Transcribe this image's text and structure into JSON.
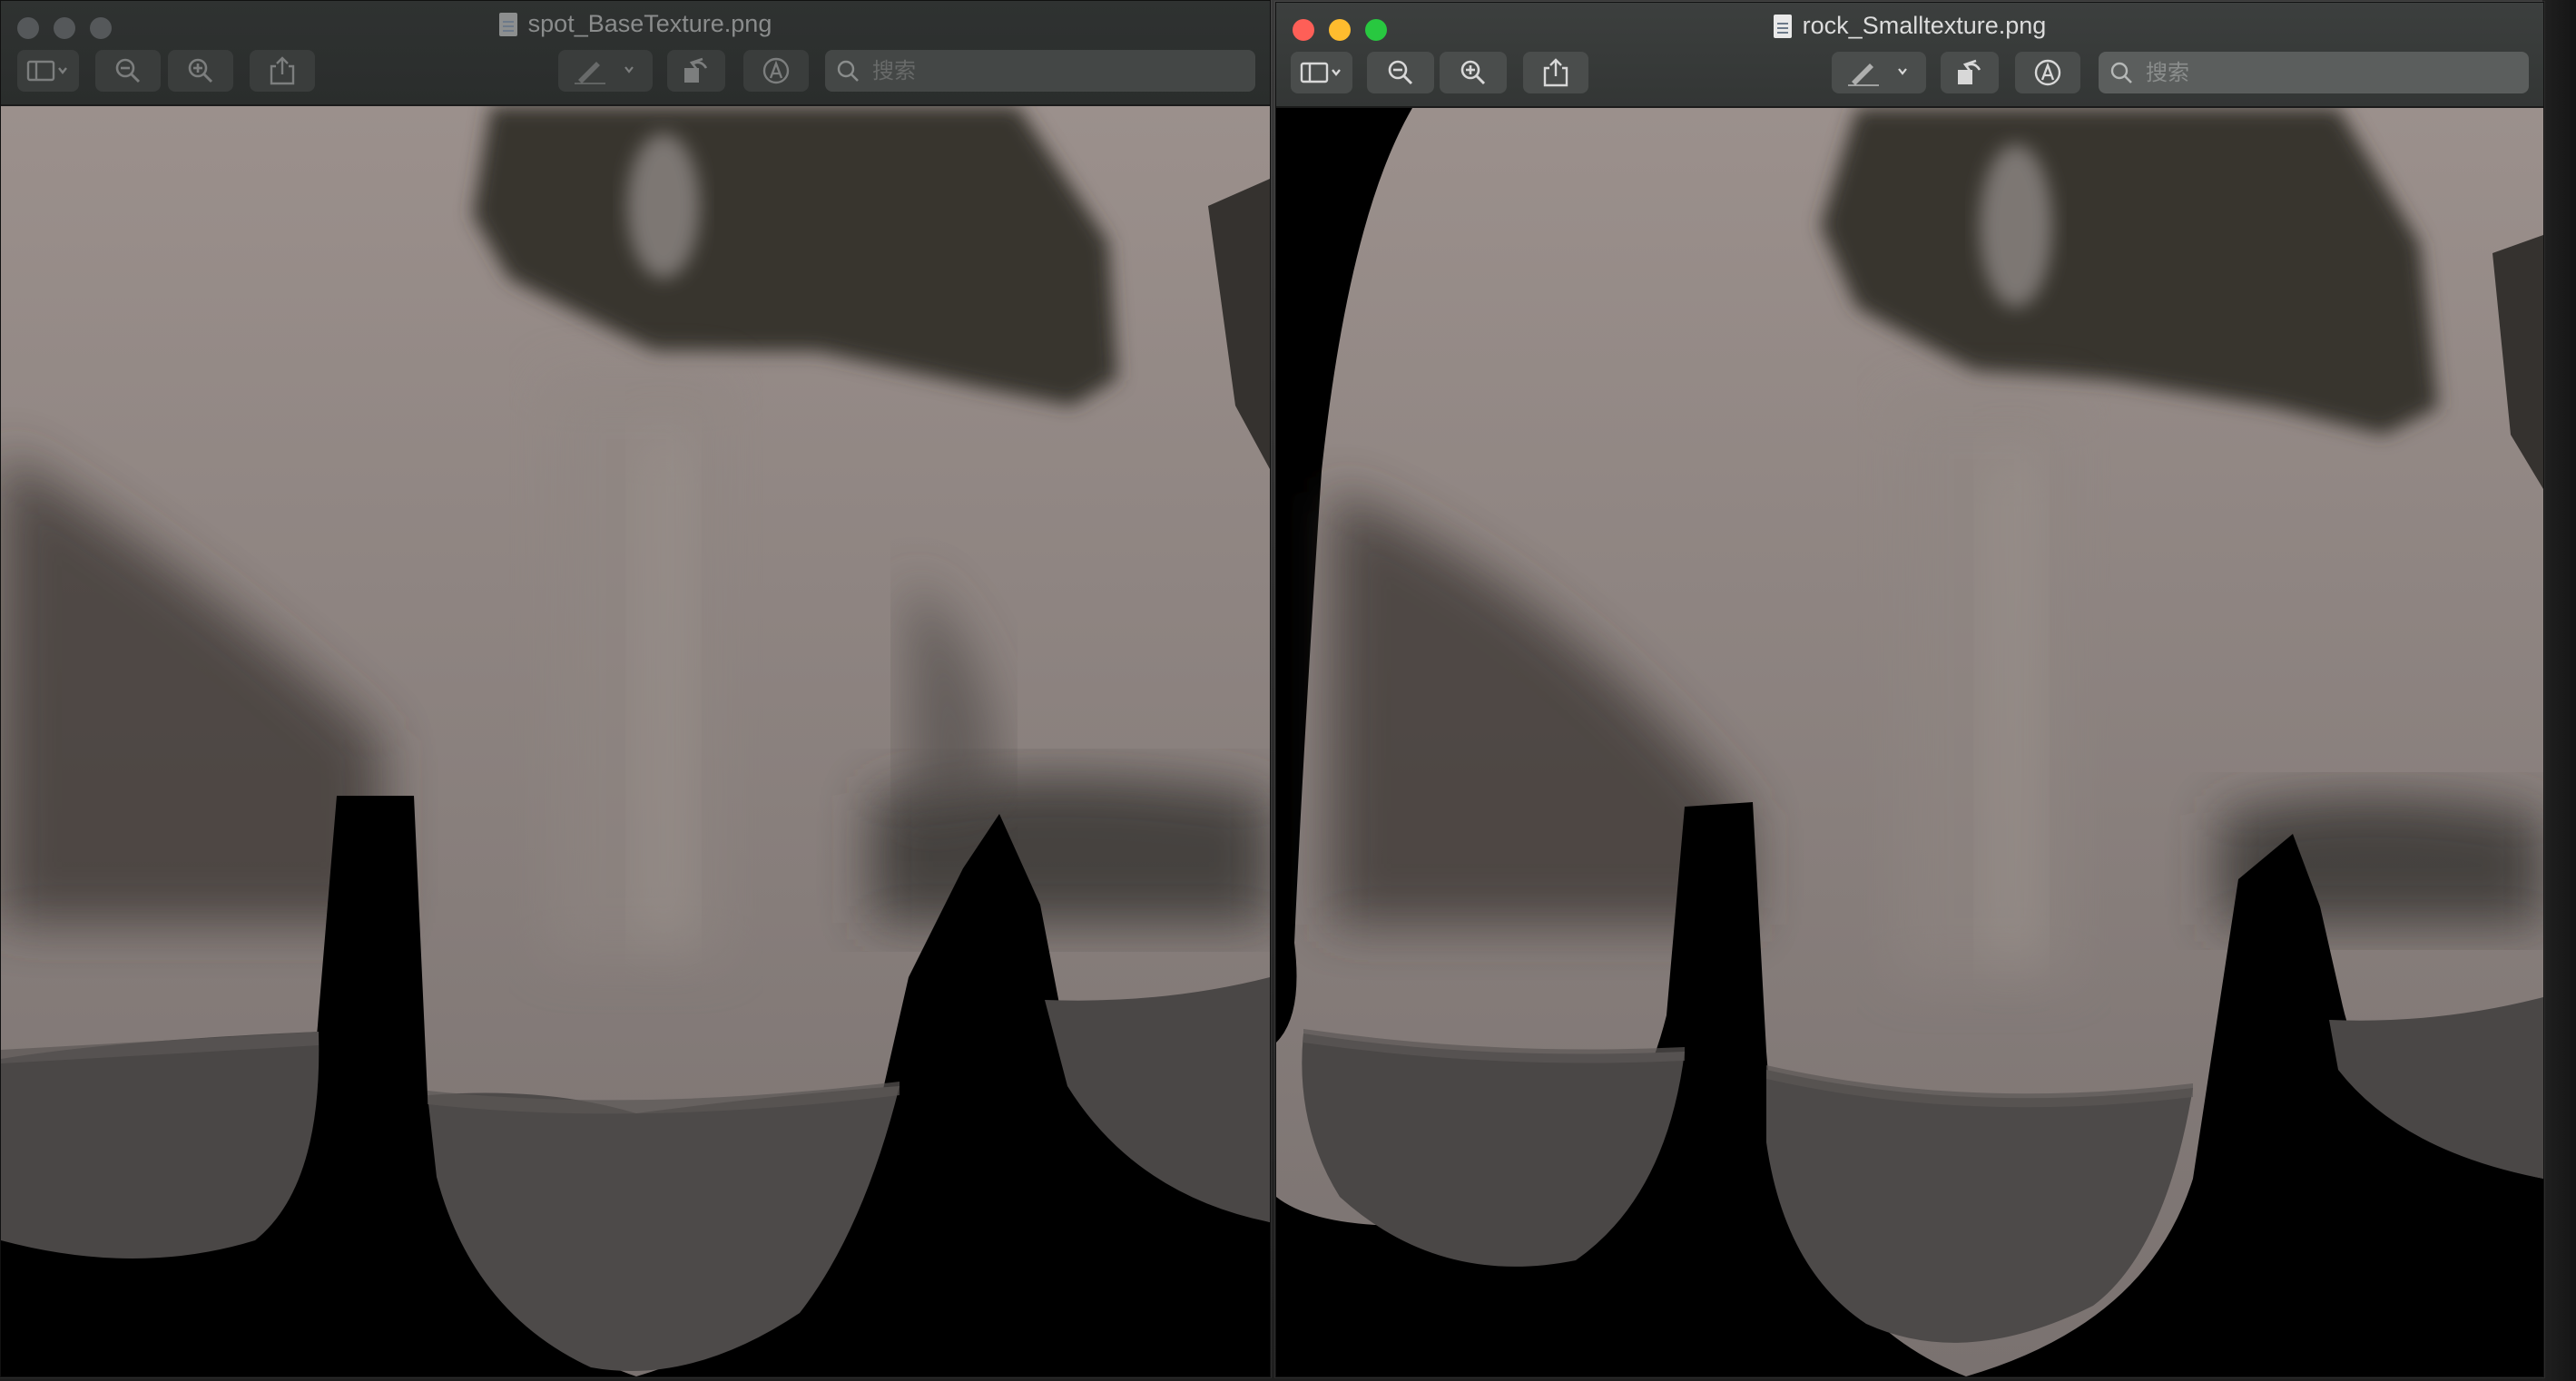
{
  "windows": [
    {
      "id": "left",
      "state": "inactive",
      "title": "spot_BaseTexture.png",
      "search_placeholder": "搜索"
    },
    {
      "id": "right",
      "state": "active",
      "title": "rock_Smalltexture.png",
      "search_placeholder": "搜索"
    }
  ],
  "toolbar_icons": [
    "sidebar-icon",
    "zoom-out-icon",
    "zoom-in-icon",
    "share-icon",
    "markup-pen-icon",
    "rotate-icon",
    "annotate-icon",
    "search-icon"
  ],
  "colors": {
    "close": "#fe5f57",
    "minimize": "#febc2e",
    "zoom": "#28c840",
    "surface": "#8c8582",
    "shadow": "#2f2d2d"
  }
}
